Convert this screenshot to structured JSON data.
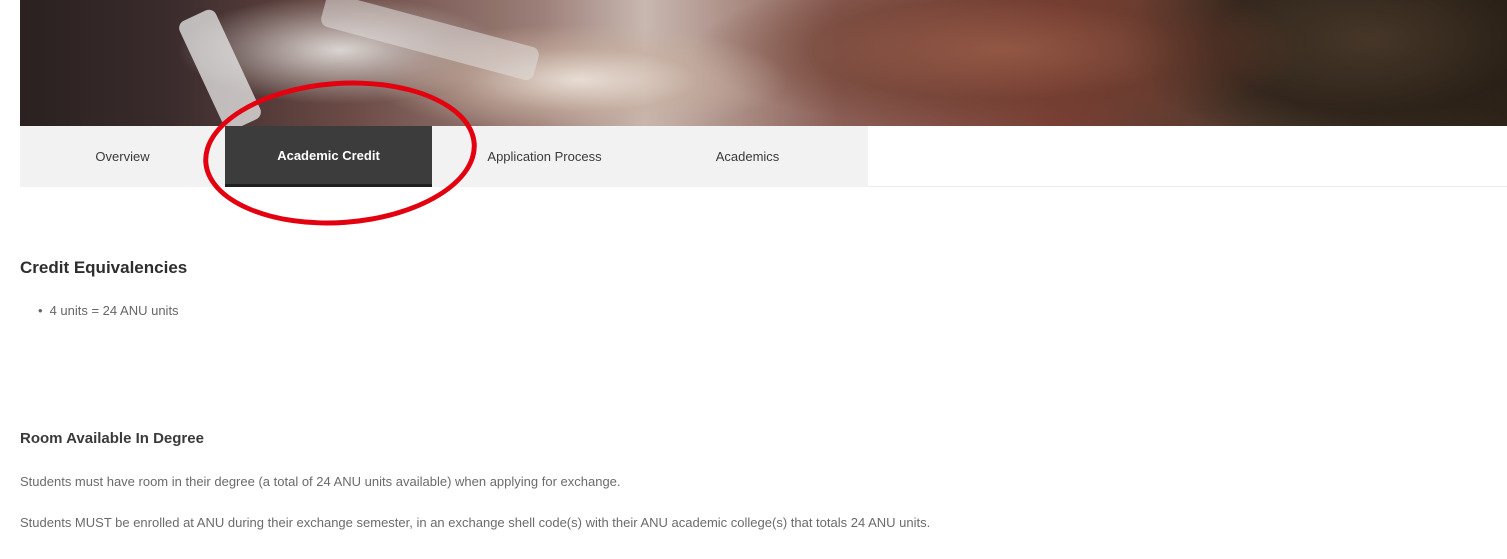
{
  "tabs": {
    "overview": "Overview",
    "academic_credit": "Academic Credit",
    "application_process": "Application Process",
    "academics": "Academics"
  },
  "colors": {
    "active_tab_bg": "#3c3c3c",
    "tabbar_bg": "#f2f2f2",
    "annotation": "#e3000f"
  },
  "credit_section": {
    "title": "Credit Equivalencies",
    "items": [
      "4 units = 24 ANU units"
    ]
  },
  "room_section": {
    "title": "Room Available In Degree",
    "paragraph1": "Students must have room in their degree (a total of 24 ANU units available) when applying for exchange.",
    "paragraph2": "Students MUST be enrolled at ANU during their exchange semester, in an exchange shell code(s) with their ANU academic college(s) that totals 24 ANU units."
  }
}
